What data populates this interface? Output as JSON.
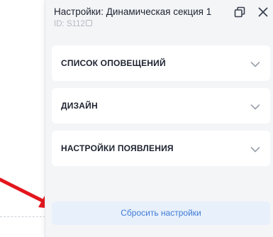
{
  "panel": {
    "title": "Настройки: Динамическая секция 1",
    "id_label": "ID: S112"
  },
  "sections": [
    {
      "label": "СПИСОК ОПОВЕЩЕНИЙ"
    },
    {
      "label": "ДИЗАЙН"
    },
    {
      "label": "НАСТРОЙКИ ПОЯВЛЕНИЯ"
    }
  ],
  "reset_button": {
    "label": "Сбросить настройки"
  },
  "colors": {
    "panel_bg": "#f4f5f7",
    "section_bg": "#ffffff",
    "reset_bg": "#e8f0fb",
    "reset_text": "#3e7bd6",
    "arrow": "#e3171e"
  },
  "icons": {
    "detach": "detach-window-icon",
    "close": "close-icon",
    "copy": "copy-icon",
    "chevron": "chevron-down-icon"
  }
}
